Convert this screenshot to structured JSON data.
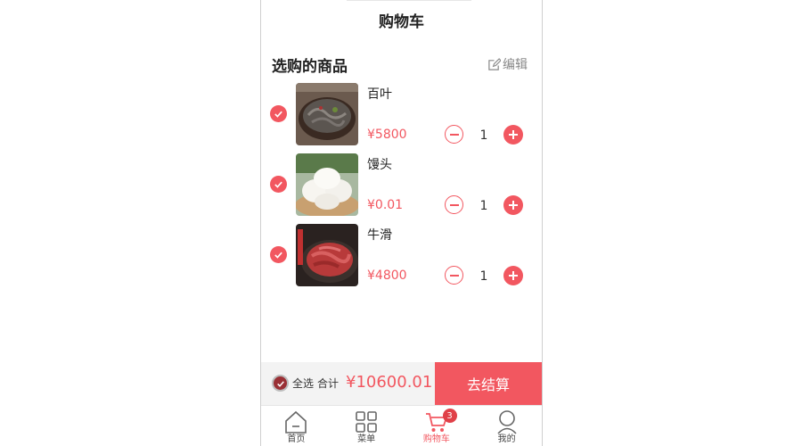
{
  "header": {
    "title": "购物车"
  },
  "section": {
    "title": "选购的商品",
    "edit_label": "编辑"
  },
  "items": [
    {
      "name": "百叶",
      "price": "¥5800",
      "quantity": "1",
      "image": "tripe-dish-image"
    },
    {
      "name": "馒头",
      "price": "¥0.01",
      "quantity": "1",
      "image": "steamed-buns-image"
    },
    {
      "name": "牛滑",
      "price": "¥4800",
      "quantity": "1",
      "image": "beef-slices-image"
    }
  ],
  "footer": {
    "select_all_label": "全选",
    "total_label": "合计",
    "total_value": "¥10600.01",
    "checkout_label": "去结算"
  },
  "tabbar": {
    "tabs": [
      {
        "label": "首页",
        "icon": "home-icon"
      },
      {
        "label": "菜单",
        "icon": "menu-grid-icon"
      },
      {
        "label": "购物车",
        "icon": "cart-icon",
        "badge": "3",
        "active": true
      },
      {
        "label": "我的",
        "icon": "user-icon"
      }
    ]
  },
  "colors": {
    "accent": "#f25760",
    "badge": "#e04048"
  }
}
